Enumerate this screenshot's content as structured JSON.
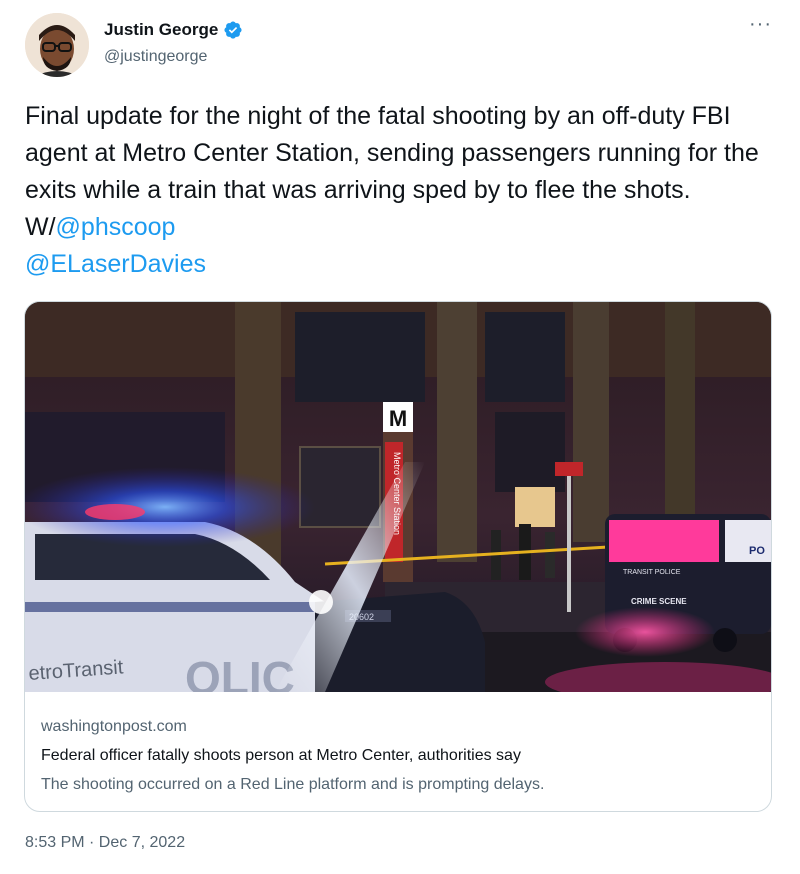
{
  "tweet": {
    "author": {
      "name": "Justin George",
      "handle": "@justingeorge",
      "verified": true,
      "avatar_icon": "person-avatar-icon"
    },
    "more_icon": "more-dots-icon",
    "more_glyph": "···",
    "text": "Final update for the night of the fatal shooting by an off-duty FBI agent at Metro Center Station, sending passengers running for the exits while a train that was arriving sped by to flee the shots. W/",
    "mentions": [
      "@phscoop",
      "@ELaserDavies"
    ],
    "timestamp": "8:53 PM · Dec 7, 2022"
  },
  "link_card": {
    "domain": "washingtonpost.com",
    "title": "Federal officer fatally shoots person at Metro Center, authorities say",
    "description": "The shooting occurred on a Red Line platform and is prompting delays.",
    "image": {
      "metro_sign": "M",
      "station_pylon_text": "Metro Center Station",
      "car_left_text": "etroTransit",
      "car_left_big_text": "OLIC",
      "car_left_number": "20602",
      "van_header": "TRANSIT POLICE",
      "van_label": "CRIME SCENE",
      "van_side_text": "PO"
    }
  },
  "colors": {
    "accent": "#1d9bf0",
    "text_primary": "#0f1419",
    "text_secondary": "#536471",
    "border": "#cfd9de"
  }
}
